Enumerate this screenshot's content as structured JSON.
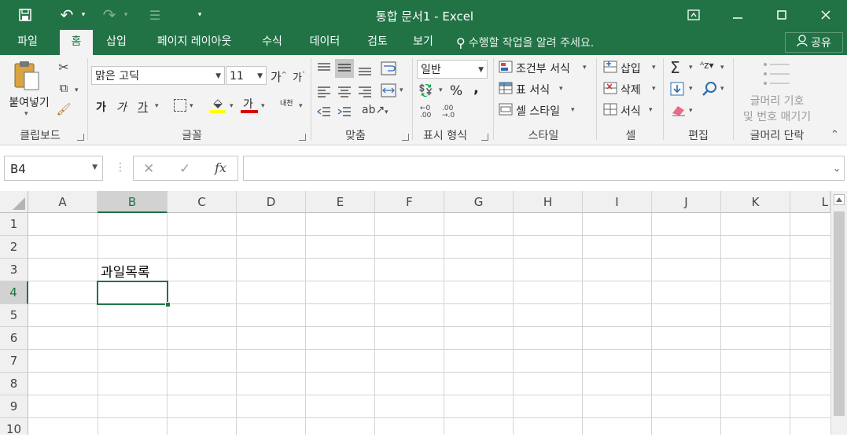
{
  "window": {
    "title": "통합 문서1 - Excel"
  },
  "tabs": [
    {
      "label": "파일"
    },
    {
      "label": "홈"
    },
    {
      "label": "삽입"
    },
    {
      "label": "페이지 레이아웃"
    },
    {
      "label": "수식"
    },
    {
      "label": "데이터"
    },
    {
      "label": "검토"
    },
    {
      "label": "보기"
    }
  ],
  "active_tab": "홈",
  "tell_me": {
    "placeholder": "수행할 작업을 알려 주세요."
  },
  "share": {
    "label": "공유"
  },
  "ribbon": {
    "clipboard": {
      "paste_label": "붙여넣기",
      "group_label": "클립보드"
    },
    "font": {
      "font_name": "맑은 고딕",
      "font_size": "11",
      "group_label": "글꼴",
      "bold": "가",
      "italic": "가",
      "underline": "가",
      "font_color_glyph": "가",
      "phonetic_glyph": "내천"
    },
    "alignment": {
      "group_label": "맞춤"
    },
    "number": {
      "format": "일반",
      "percent": "%",
      "comma": ",",
      "group_label": "표시 형식"
    },
    "styles": {
      "conditional": "조건부 서식",
      "table": "표 서식",
      "cell_style": "셀 스타일",
      "group_label": "스타일"
    },
    "cells": {
      "insert": "삽입",
      "delete": "삭제",
      "format": "서식",
      "group_label": "셀"
    },
    "editing": {
      "group_label": "편집"
    },
    "bullets": {
      "line1": "글머리 기호",
      "line2": "및 번호 매기기",
      "group_label": "글머리 단락"
    }
  },
  "formula_bar": {
    "name_box": "B4",
    "fx": "fx",
    "formula": ""
  },
  "grid": {
    "columns": [
      "A",
      "B",
      "C",
      "D",
      "E",
      "F",
      "G",
      "H",
      "I",
      "J",
      "K",
      "L"
    ],
    "rows": [
      "1",
      "2",
      "3",
      "4",
      "5",
      "6",
      "7",
      "8",
      "9",
      "10"
    ],
    "selected_col": "B",
    "selected_row": "4",
    "cells": {
      "B3": "과일목록"
    }
  },
  "colors": {
    "accent": "#217346",
    "ribbon_bg": "#f3f3f3",
    "header_bg": "#f0f0f0"
  }
}
